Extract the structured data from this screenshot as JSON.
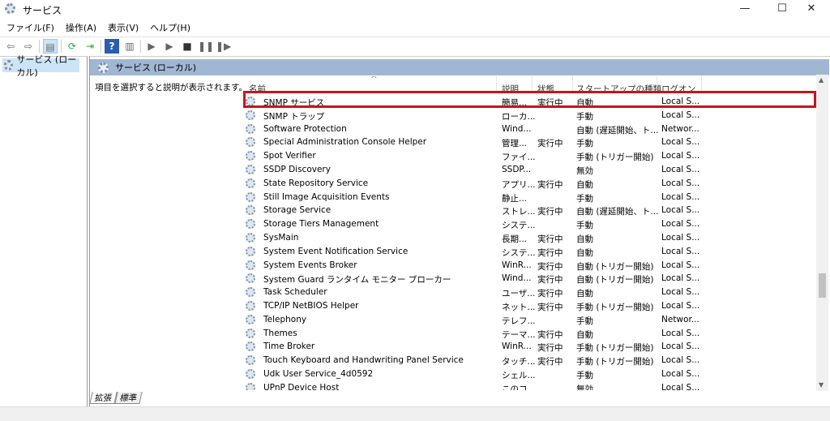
{
  "window": {
    "title": "サービス",
    "minimize": "—",
    "maximize": "☐",
    "close": "✕"
  },
  "menu": [
    "ファイル(F)",
    "操作(A)",
    "表示(V)",
    "ヘルプ(H)"
  ],
  "toolbar": {
    "icons": [
      "back-arrow-icon",
      "forward-arrow-icon",
      "show-hide-console-tree-icon",
      "refresh-icon",
      "export-list-icon",
      "help-icon",
      "properties-pane-icon",
      "start-service-icon",
      "start-service-alt-icon",
      "stop-service-icon",
      "pause-service-icon",
      "restart-service-icon"
    ]
  },
  "tree": {
    "root": "サービス (ローカル)"
  },
  "pane": {
    "header": "サービス (ローカル)",
    "description": "項目を選択すると説明が表示されます。"
  },
  "columns": {
    "name": "名前",
    "desc": "説明",
    "status": "状態",
    "startup": "スタートアップの種類",
    "logon": "ログオン"
  },
  "rows": [
    {
      "name": "SNMP サービス",
      "desc": "簡易...",
      "status": "実行中",
      "startup": "自動",
      "logon": "Local S...",
      "highlighted": true
    },
    {
      "name": "SNMP トラップ",
      "desc": "ローカ...",
      "status": "",
      "startup": "手動",
      "logon": "Local S..."
    },
    {
      "name": "Software Protection",
      "desc": "Wind...",
      "status": "",
      "startup": "自動 (遅延開始、ト...",
      "logon": "Networ..."
    },
    {
      "name": "Special Administration Console Helper",
      "desc": "管理...",
      "status": "実行中",
      "startup": "手動",
      "logon": "Local S..."
    },
    {
      "name": "Spot Verifier",
      "desc": "ファイ...",
      "status": "",
      "startup": "手動 (トリガー開始)",
      "logon": "Local S..."
    },
    {
      "name": "SSDP Discovery",
      "desc": "SSDP...",
      "status": "",
      "startup": "無効",
      "logon": "Local S..."
    },
    {
      "name": "State Repository Service",
      "desc": "アプリ...",
      "status": "実行中",
      "startup": "自動",
      "logon": "Local S..."
    },
    {
      "name": "Still Image Acquisition Events",
      "desc": "静止...",
      "status": "",
      "startup": "手動",
      "logon": "Local S..."
    },
    {
      "name": "Storage Service",
      "desc": "ストレ...",
      "status": "実行中",
      "startup": "自動 (遅延開始、ト...",
      "logon": "Local S..."
    },
    {
      "name": "Storage Tiers Management",
      "desc": "システ...",
      "status": "",
      "startup": "手動",
      "logon": "Local S..."
    },
    {
      "name": "SysMain",
      "desc": "長期...",
      "status": "実行中",
      "startup": "自動",
      "logon": "Local S..."
    },
    {
      "name": "System Event Notification Service",
      "desc": "システ...",
      "status": "実行中",
      "startup": "自動",
      "logon": "Local S..."
    },
    {
      "name": "System Events Broker",
      "desc": "WinR...",
      "status": "実行中",
      "startup": "自動 (トリガー開始)",
      "logon": "Local S..."
    },
    {
      "name": "System Guard ランタイム モニター ブローカー",
      "desc": "Wind...",
      "status": "実行中",
      "startup": "自動 (トリガー開始)",
      "logon": "Local S..."
    },
    {
      "name": "Task Scheduler",
      "desc": "ユーザ...",
      "status": "実行中",
      "startup": "自動",
      "logon": "Local S..."
    },
    {
      "name": "TCP/IP NetBIOS Helper",
      "desc": "ネット...",
      "status": "実行中",
      "startup": "手動 (トリガー開始)",
      "logon": "Local S..."
    },
    {
      "name": "Telephony",
      "desc": "テレフ...",
      "status": "",
      "startup": "手動",
      "logon": "Networ..."
    },
    {
      "name": "Themes",
      "desc": "テーマ...",
      "status": "実行中",
      "startup": "自動",
      "logon": "Local S..."
    },
    {
      "name": "Time Broker",
      "desc": "WinR...",
      "status": "実行中",
      "startup": "手動 (トリガー開始)",
      "logon": "Local S..."
    },
    {
      "name": "Touch Keyboard and Handwriting Panel Service",
      "desc": "タッチ...",
      "status": "実行中",
      "startup": "手動 (トリガー開始)",
      "logon": "Local S..."
    },
    {
      "name": "Udk User Service_4d0592",
      "desc": "シェル...",
      "status": "",
      "startup": "手動",
      "logon": "Local S..."
    },
    {
      "name": "UPnP Device Host",
      "desc": "このコ...",
      "status": "",
      "startup": "無効",
      "logon": "Local S..."
    }
  ],
  "tabs": [
    "拡張",
    "標準"
  ],
  "accent": "#c4161c"
}
